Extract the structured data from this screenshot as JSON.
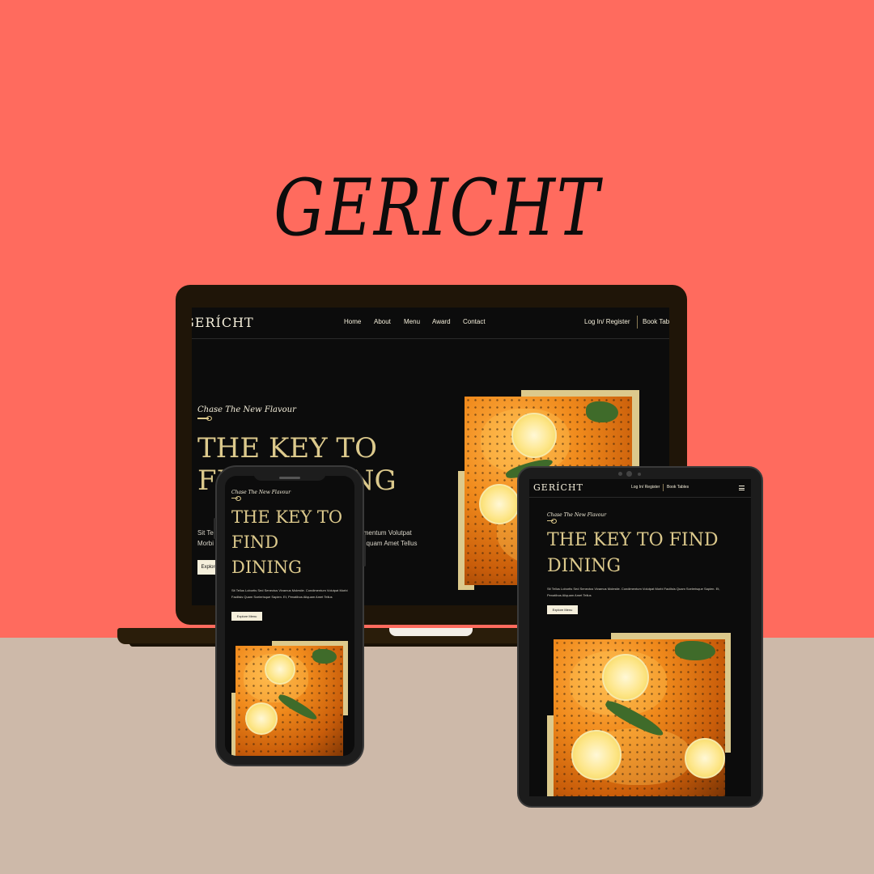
{
  "brand": {
    "title": "GERICHT"
  },
  "site": {
    "logo": "GERÍCHT",
    "nav": [
      "Home",
      "About",
      "Menu",
      "Award",
      "Contact"
    ],
    "login": "Log In/ Register",
    "book": "Book Table",
    "book_tablet": "Book Tables",
    "subtitle": "Chase The New Flavour",
    "headline": "THE KEY TO FIND DINING",
    "headline_lines": [
      "THE KEY TO",
      "FIND",
      "DINING"
    ],
    "laptop_headline_lines": [
      "THE KEY TO",
      "FIND DINING"
    ],
    "body": "Sit Tellus Lobortis Sed Senectus Vivamus Molestie. Condimentum Volutpat Morbi Facilisis Quam Scelerisque Sapien. Et, Penatibus Aliquam Amet Tellus",
    "laptop_body_lines": [
      "Sit Tellus Lobortis Sed Senectus Vivamus Molestie. Condimentum Volutpat",
      "Morbi Facilisis Quam Scelerisque Sapien. Et, Penatibus Aliquam Amet Tellus"
    ],
    "cta": "Explore Menu"
  },
  "colors": {
    "background_top": "#ff6b5e",
    "background_bottom": "#cdb9a9",
    "site_background": "#0c0c0c",
    "accent_gold": "#dcc98c",
    "cream": "#f5efdb"
  },
  "icons": {
    "menu": "hamburger-menu-icon",
    "spoon": "spoon-divider-icon"
  }
}
